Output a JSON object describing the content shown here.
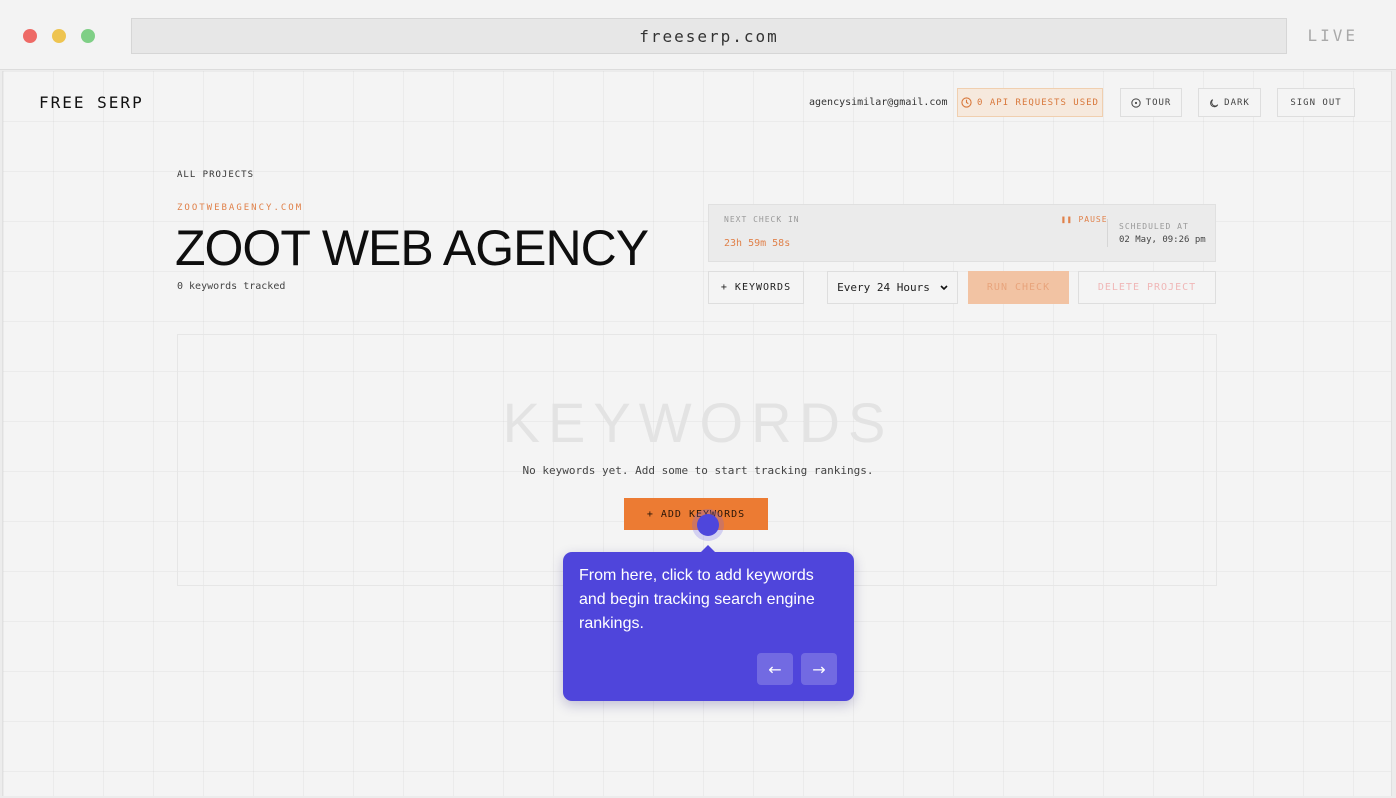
{
  "browser": {
    "url": "freeserp.com",
    "status": "LIVE"
  },
  "header": {
    "logo": "FREE SERP",
    "email": "agencysimilar@gmail.com",
    "api_requests": "0 API REQUESTS USED",
    "tour": "TOUR",
    "dark": "DARK",
    "sign_out": "SIGN OUT"
  },
  "project": {
    "breadcrumb": "ALL PROJECTS",
    "domain": "ZOOTWEBAGENCY.COM",
    "title": "ZOOT WEB AGENCY",
    "tracked": "0 keywords tracked"
  },
  "schedule": {
    "next_check_label": "NEXT CHECK IN",
    "countdown": "23h 59m 58s",
    "pause_label": "PAUSE",
    "scheduled_label": "SCHEDULED AT",
    "scheduled_date": "02 May, 09:26 pm"
  },
  "actions": {
    "keywords_button": "+ KEYWORDS",
    "frequency": "Every 24 Hours",
    "run_check": "RUN CHECK",
    "delete_project": "DELETE PROJECT"
  },
  "keywords_panel": {
    "heading": "KEYWORDS",
    "empty_text": "No keywords yet. Add some to start tracking rankings.",
    "add_button": "+ ADD KEYWORDS"
  },
  "tour_tooltip": {
    "text": "From here, click to add keywords and begin tracking search engine rankings.",
    "prev_icon": "arrow-left-icon",
    "next_icon": "arrow-right-icon"
  },
  "colors": {
    "accent": "#ec7b33",
    "tour": "#4f45db"
  }
}
